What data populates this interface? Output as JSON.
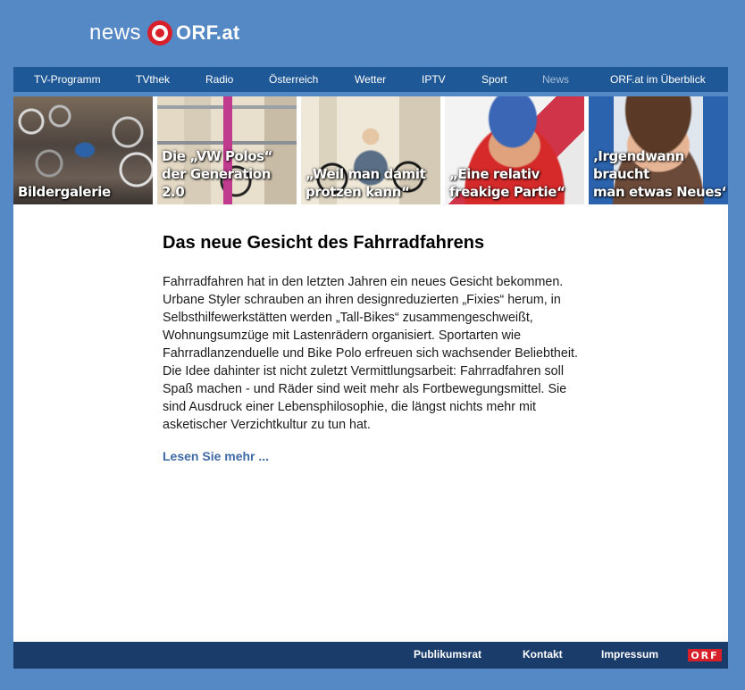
{
  "brand": {
    "news": "news",
    "orf": "ORF.at"
  },
  "nav": {
    "items": [
      {
        "label": "TV-Programm"
      },
      {
        "label": "TVthek"
      },
      {
        "label": "Radio"
      },
      {
        "label": "Österreich"
      },
      {
        "label": "Wetter"
      },
      {
        "label": "IPTV"
      },
      {
        "label": "Sport"
      },
      {
        "label": "News",
        "active": true
      },
      {
        "label": "ORF.at im Überblick"
      }
    ]
  },
  "teasers": [
    {
      "caption": "Bildergalerie"
    },
    {
      "caption": "Die „VW Polos“\nder Generation 2.0"
    },
    {
      "caption": "„Weil man damit\nprotzen kann“"
    },
    {
      "caption": "„Eine relativ\nfreakige Partie“"
    },
    {
      "caption": "‚Irgendwann braucht\nman etwas Neues‘"
    }
  ],
  "article": {
    "title": "Das neue Gesicht des Fahrradfahrens",
    "body": "Fahrradfahren hat in den letzten Jahren ein neues Gesicht bekommen. Urbane Styler schrauben an ihren designreduzierten „Fixies“ herum, in Selbsthilfewerkstätten werden „Tall-Bikes“ zusammengeschweißt, Wohnungsumzüge mit Lastenrädern organisiert. Sportarten wie Fahrradlanzenduelle und Bike Polo erfreuen sich wachsender Beliebtheit. Die Idee dahinter ist nicht zuletzt Vermittlungsarbeit: Fahrradfahren soll Spaß machen - und Räder sind weit mehr als Fortbewegungsmittel. Sie sind Ausdruck einer Lebensphilosophie, die längst nichts mehr mit asketischer Verzichtkultur zu tun hat.",
    "more": "Lesen Sie mehr ..."
  },
  "footer": {
    "links": [
      {
        "label": "Publikumsrat"
      },
      {
        "label": "Kontakt"
      },
      {
        "label": "Impressum"
      }
    ],
    "logo": "ORF"
  },
  "colors": {
    "background": "#5589c6",
    "nav": "#1f5896",
    "footer": "#1a3c6a",
    "link": "#3f6aa5",
    "brand_red": "#d8202a"
  }
}
